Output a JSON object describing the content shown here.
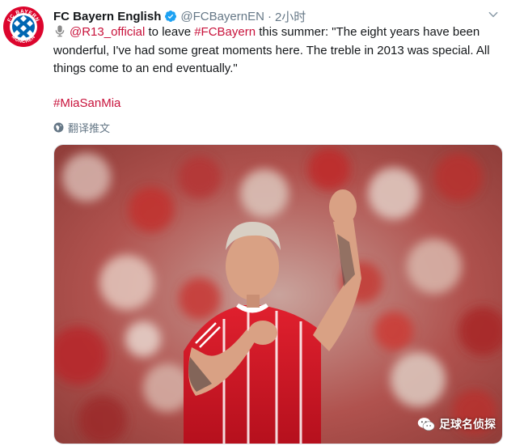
{
  "tweet": {
    "author": {
      "name": "FC Bayern English",
      "handle": "@FCBayernEN",
      "verified": true,
      "avatar_logo_text": [
        "FC BAYERN",
        "MÜNCHEN"
      ],
      "avatar_color": "#dc052d"
    },
    "separator": "·",
    "time": "2小时",
    "body": {
      "mention": "@R13_official",
      "text_after_mention": " to leave ",
      "hashtag_inline": "#FCBayern",
      "quote": " this summer: \"The eight years have been wonderful, I've had some great moments here. The treble in 2013 was special. All things come to an end eventually.\""
    },
    "hashtag": "#MiaSanMia",
    "translate_label": "翻译推文",
    "link_color": "#c8123b"
  },
  "photo": {
    "description_icon": "player-photo",
    "watermark_text": "足球名侦探"
  }
}
